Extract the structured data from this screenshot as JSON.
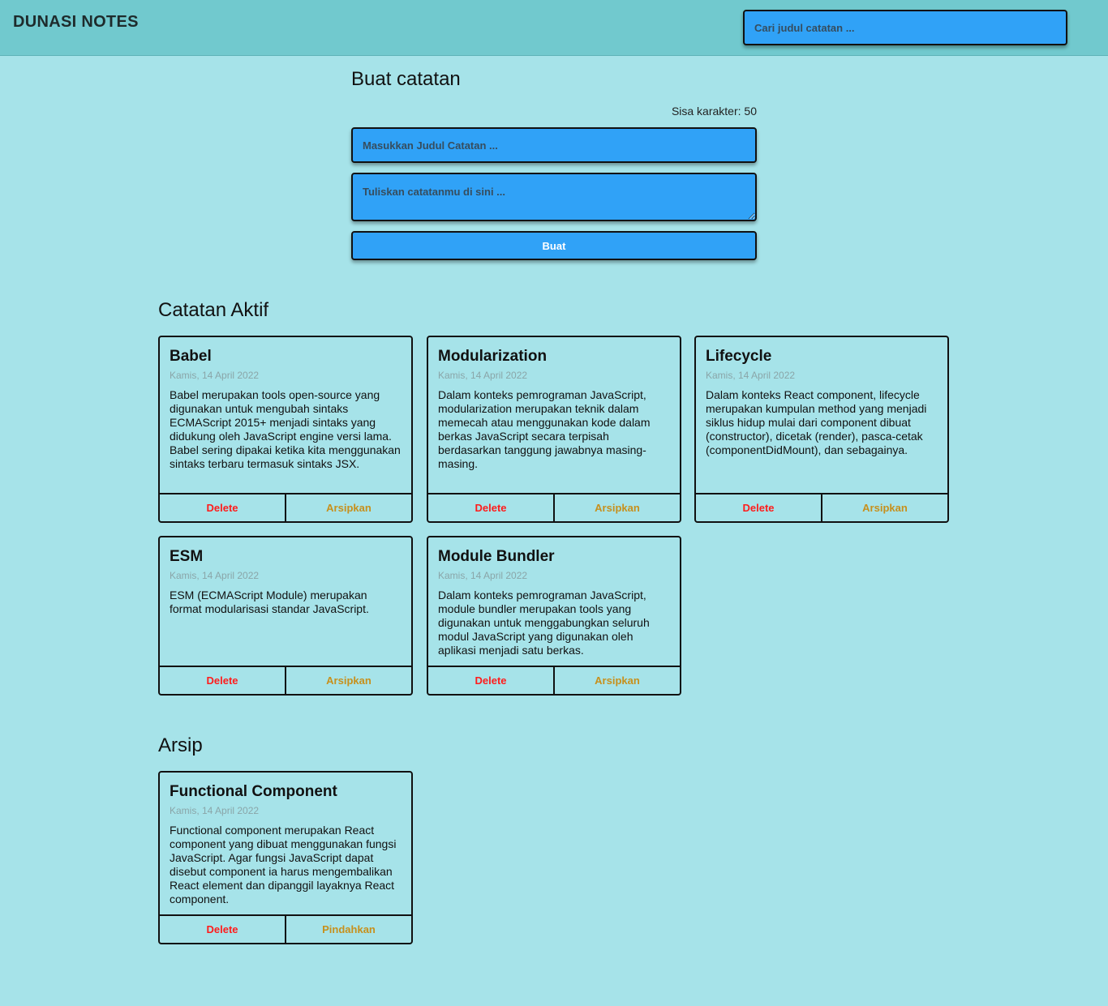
{
  "header": {
    "app_title": "DUNASI NOTES",
    "search_placeholder": "Cari judul catatan ..."
  },
  "create": {
    "heading": "Buat catatan",
    "char_counter": "Sisa karakter: 50",
    "title_placeholder": "Masukkan Judul Catatan ...",
    "body_placeholder": "Tuliskan catatanmu di sini ...",
    "submit_label": "Buat"
  },
  "active": {
    "heading": "Catatan Aktif",
    "notes": [
      {
        "title": "Babel",
        "date": "Kamis, 14 April 2022",
        "body": "Babel merupakan tools open-source yang digunakan untuk mengubah sintaks ECMAScript 2015+ menjadi sintaks yang didukung oleh JavaScript engine versi lama. Babel sering dipakai ketika kita menggunakan sintaks terbaru termasuk sintaks JSX.",
        "delete_label": "Delete",
        "action_label": "Arsipkan"
      },
      {
        "title": "Modularization",
        "date": "Kamis, 14 April 2022",
        "body": "Dalam konteks pemrograman JavaScript, modularization merupakan teknik dalam memecah atau menggunakan kode dalam berkas JavaScript secara terpisah berdasarkan tanggung jawabnya masing-masing.",
        "delete_label": "Delete",
        "action_label": "Arsipkan"
      },
      {
        "title": "Lifecycle",
        "date": "Kamis, 14 April 2022",
        "body": "Dalam konteks React component, lifecycle merupakan kumpulan method yang menjadi siklus hidup mulai dari component dibuat (constructor), dicetak (render), pasca-cetak (componentDidMount), dan sebagainya.",
        "delete_label": "Delete",
        "action_label": "Arsipkan"
      },
      {
        "title": "ESM",
        "date": "Kamis, 14 April 2022",
        "body": "ESM (ECMAScript Module) merupakan format modularisasi standar JavaScript.",
        "delete_label": "Delete",
        "action_label": "Arsipkan"
      },
      {
        "title": "Module Bundler",
        "date": "Kamis, 14 April 2022",
        "body": "Dalam konteks pemrograman JavaScript, module bundler merupakan tools yang digunakan untuk menggabungkan seluruh modul JavaScript yang digunakan oleh aplikasi menjadi satu berkas.",
        "delete_label": "Delete",
        "action_label": "Arsipkan"
      }
    ]
  },
  "archive": {
    "heading": "Arsip",
    "notes": [
      {
        "title": "Functional Component",
        "date": "Kamis, 14 April 2022",
        "body": "Functional component merupakan React component yang dibuat menggunakan fungsi JavaScript. Agar fungsi JavaScript dapat disebut component ia harus mengembalikan React element dan dipanggil layaknya React component.",
        "delete_label": "Delete",
        "action_label": "Pindahkan"
      }
    ]
  },
  "colors": {
    "page_background": "#a6e3e9",
    "header_background": "#71c9ce",
    "input_background": "#30a2f7",
    "delete_text": "#ff1c1c",
    "archive_text": "#c7901c",
    "date_text": "#8aa5a8"
  }
}
